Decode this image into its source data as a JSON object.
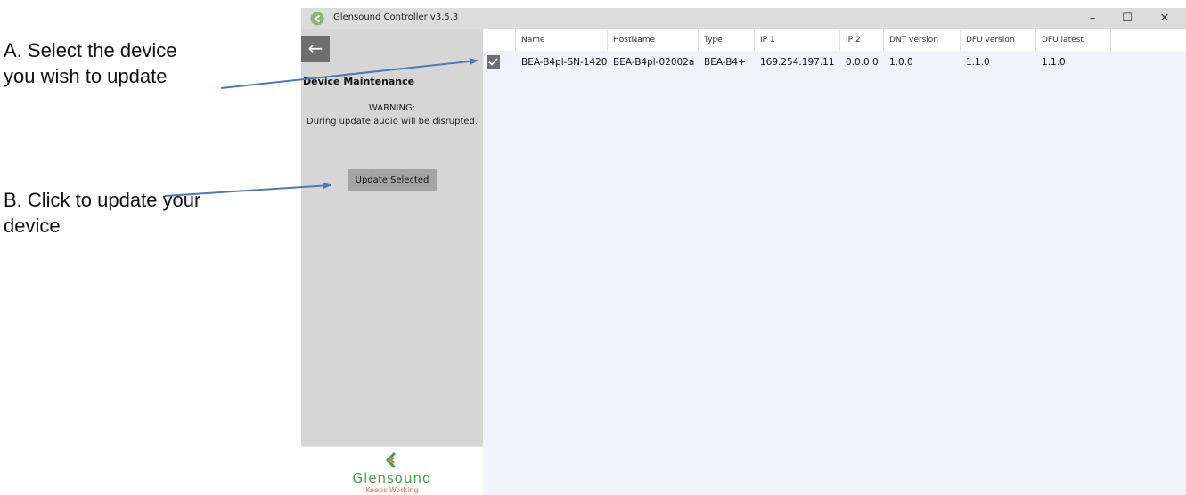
{
  "annotations": {
    "a_text": "A. Select the device you wish to update",
    "b_text": "B. Click to update your device"
  },
  "window": {
    "title": "Glensound Controller v3.5.3",
    "controls": {
      "minimize": "–",
      "maximize": "☐",
      "close": "✕"
    }
  },
  "sidebar": {
    "back_glyph": "←",
    "title": "Device Maintenance",
    "warning_title": "WARNING:",
    "warning_text": "During update audio will be disrupted.",
    "update_button": "Update Selected"
  },
  "logo": {
    "wordmark": "Glensound",
    "tagline": "Keeps Working"
  },
  "table": {
    "columns": [
      "Name",
      "HostName",
      "Type",
      "IP 1",
      "IP 2",
      "DNT version",
      "DFU version",
      "DFU latest"
    ],
    "rows": [
      {
        "checked": true,
        "cells": [
          "BEA-B4pl-SN-1420",
          "BEA-B4pl-02002a",
          "BEA-B4+",
          "169.254.197.11",
          "0.0.0.0",
          "1.0.0",
          "1.1.0",
          "1.1.0"
        ]
      }
    ]
  },
  "colors": {
    "arrow": "#4a7ab8",
    "logo_green": "#3aa64a",
    "logo_orange": "#e36a2e"
  }
}
